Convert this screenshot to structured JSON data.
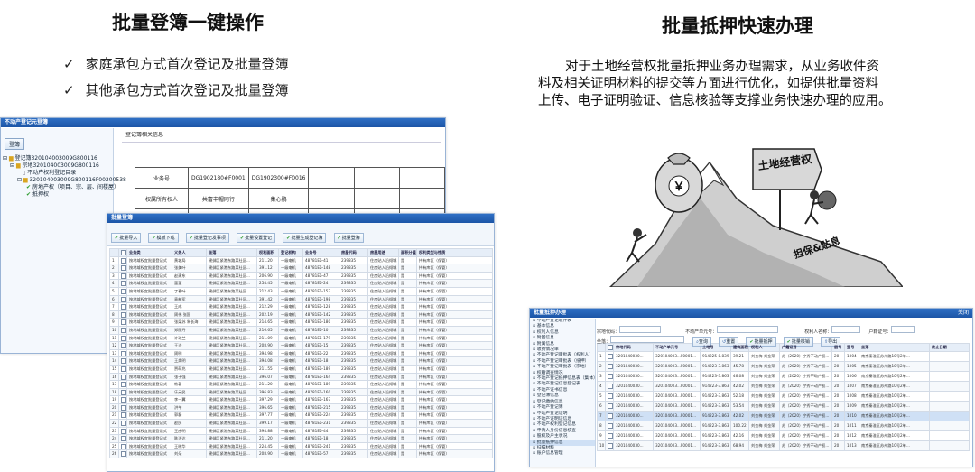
{
  "left_section": {
    "title": "批量登簿一键操作",
    "bullets": [
      "家庭承包方式首次登记及批量登簿",
      "其他承包方式首次登记及批量登簿"
    ],
    "bullet_mark": "✓"
  },
  "right_section": {
    "title": "批量抵押快速办理",
    "paragraph_lines": [
      "对于土地经营权批量抵押业务办理需求，从业务收件资",
      "料及相关证明材料的提交等方面进行优化，如提供批量资料",
      "上传、电子证明验证、信息核验等支撑业务快速办理的应用。"
    ]
  },
  "illustration": {
    "sign_text": "土地经营权",
    "bag_text": "￥",
    "slope_text": "担保&贴息"
  },
  "tree_window": {
    "title": "不动产登记元登簿",
    "button_label": "登簿",
    "items": [
      "登记簿320104003009G800116",
      "宗地320104003009G800116",
      "不动产权利登记目录",
      "320104003009G800116F00200538",
      "房地产权（项目、宗、层、间楼屋）",
      "抵押权"
    ],
    "panel_title": "登记簿相关信息"
  },
  "register_table": {
    "rows": [
      [
        "业务号",
        "DG1902180#F0001",
        "DG1902300#F0016",
        "",
        "",
        ""
      ],
      [
        "权属所有权人",
        "共富丰帽同行",
        "集心鹏",
        "",
        "",
        ""
      ],
      [
        "证件种类",
        "身份证",
        "户口簿",
        "",
        "",
        ""
      ]
    ]
  },
  "batch_window": {
    "title": "批量登簿",
    "toolbar": [
      "批量导入",
      "模板下载",
      "批量登记发事项",
      "批量设置登记",
      "批量生成登记簿",
      "批量登簿"
    ],
    "columns": [
      "",
      "",
      "业务类",
      "义务人",
      "坐落",
      "权利面积",
      "登记机构",
      "业务号",
      "房屋代码",
      "房屋用途",
      "面积分值",
      "权利类型与性质"
    ],
    "row_template": {
      "type": "按地域权宜批量登记式",
      "location": "建邺区紧港东路某社区...",
      "agency": "一级电机",
      "code": "239835",
      "usage": "住房贴入沿倾城",
      "area_flag": "是",
      "right": "持有库区（保管）"
    },
    "owners": [
      "黄坡局",
      "张美叶",
      "赵建东",
      "董董",
      "丁春叶",
      "袁新军",
      "王成",
      "周伟 张国",
      "张梁苏 朱长海",
      "郑丽丹",
      "许琼兰",
      "王沙",
      "周明",
      "王焕明",
      "贾萌兆",
      "张子强",
      "韩着",
      "乐元民",
      "李一翼",
      "洪芊",
      "郭磊",
      "赵民",
      "王彦明",
      "陈洪达",
      "王晓华",
      "刘朵"
    ],
    "areas": [
      "211.20",
      "391.12",
      "206.90",
      "254.45",
      "212.43",
      "391.42",
      "212.29",
      "202.19",
      "214.65",
      "216.65",
      "211.09",
      "208.90",
      "394.98",
      "394.08",
      "211.55",
      "396.07",
      "211.20",
      "396.83",
      "397.29",
      "396.65",
      "397.77",
      "399.17",
      "394.88",
      "211.20",
      "224.45",
      "208.90"
    ],
    "biz_nos": [
      "48781E5-41",
      "48781E5-148",
      "48781E5-47",
      "48781E5-24",
      "48781E5-157",
      "48781E5-198",
      "48781E5-128",
      "48781E5-142",
      "48781E5-180",
      "48781E5-10",
      "48781E5-179",
      "48781E5-15",
      "48781E5-22",
      "48781E5-18",
      "48781E5-189",
      "48781E5-164",
      "48781E5-189",
      "48781E5-160",
      "48781E5-167",
      "48781E5-215",
      "48781E5-224",
      "48781E5-231",
      "48781E5-44",
      "48781E5-18",
      "48781E5-241",
      "48781E5-57"
    ]
  },
  "mortgage_window": {
    "title": "批量抵押办理",
    "close_label": "关闭",
    "nav_items": [
      "不动产登记收件表",
      "基本信息",
      "权利人信息",
      "附图信息",
      "附属信息",
      "收费情况单",
      "不动产登记审批表（权利人）",
      "不动产登记审批表（抵押）",
      "不动产登记审批表（宗地）",
      "权籍调查情况",
      "不动产登记抵押信息表（集体）",
      "不动产登记信息登记表",
      "不动产证书信息",
      "登记簿信息",
      "登记缴纳信息",
      "不动产登记簿",
      "不动产登记证明",
      "不动产证明证信息",
      "不动产权利登记信息",
      "申请人身份信息核查",
      "股权及户主状况",
      "批量抵押信息",
      "扫描材料",
      "账户信息管理"
    ],
    "filters": [
      "宗地代码：",
      "不动产单元号：",
      "权利人名称：",
      "户籍证号："
    ],
    "filter2": "坐落：",
    "buttons": [
      "查询",
      "重置",
      "批量抵押",
      "批量核销",
      "导出"
    ],
    "columns": [
      "",
      "",
      "宗地代码",
      "不动产单元号",
      "土地号",
      "建筑面积",
      "权利人",
      "户籍证号",
      "层号",
      "室号",
      "坐落",
      "终止日期"
    ],
    "rows": [
      [
        "1",
        "",
        "3201040030...",
        "320104003...F0001...",
        "914225-8.839",
        "39.21",
        "刘金梅 刘金荣",
        "苏（2020）宁秀不动产权...",
        "20",
        "1004",
        "南京秦淮区苏州路10号2单..."
      ],
      [
        "2",
        "",
        "3201040030...",
        "320104003...F0001...",
        "914223-3.863",
        "45.78",
        "刘金梅 刘金荣",
        "苏（2020）宁秀不动产权...",
        "20",
        "1005",
        "南京秦淮区苏州路10号2单..."
      ],
      [
        "3",
        "",
        "3201040030...",
        "320104003...F0001...",
        "914223-3.863",
        "46.08",
        "刘金梅 刘金荣",
        "苏（2020）宁秀不动产权...",
        "20",
        "1006",
        "南京秦淮区苏州路10号2单..."
      ],
      [
        "4",
        "",
        "3201040030...",
        "320104003...F0001...",
        "914223-3.863",
        "42.02",
        "刘金梅 刘金荣",
        "苏（2020）宁秀不动产权...",
        "20",
        "1007",
        "南京秦淮区苏州路10号2单..."
      ],
      [
        "5",
        "",
        "3201040030...",
        "320104003...F0001...",
        "914223-3.863",
        "52.18",
        "刘金梅 刘金荣",
        "苏（2020）宁秀不动产权...",
        "20",
        "1008",
        "南京秦淮区苏州路10号2单..."
      ],
      [
        "6",
        "",
        "3201040030...",
        "320104003...F0001...",
        "914223-3.863",
        "53.54",
        "刘金梅 刘金荣",
        "苏（2020）宁秀不动产权...",
        "20",
        "1009",
        "南京秦淮区苏州路10号2单..."
      ],
      [
        "7",
        "",
        "3201040030...",
        "320104003...F0001...",
        "914223-3.863",
        "42.02",
        "刘金梅 刘金荣",
        "苏（2020）宁秀不动产权...",
        "20",
        "1010",
        "南京秦淮区苏州路10号2单..."
      ],
      [
        "8",
        "",
        "3201040030...",
        "320104003...F0001...",
        "914223-3.863",
        "100.22",
        "刘金梅 刘金荣",
        "苏（2020）宁秀不动产权...",
        "20",
        "1011",
        "南京秦淮区苏州路10号2单..."
      ],
      [
        "9",
        "",
        "3201040030...",
        "320104003...F0001...",
        "914223-3.863",
        "42.16",
        "刘金梅 刘金荣",
        "苏（2020）宁秀不动产权...",
        "20",
        "1012",
        "南京秦淮区苏州路10号2单..."
      ],
      [
        "10",
        "",
        "3201040030...",
        "320104003...F0001...",
        "914223-3.863",
        "68.94",
        "刘金梅 刘金荣",
        "苏（2020）宁秀不动产权...",
        "20",
        "1013",
        "南京秦淮区苏州路10号2单..."
      ]
    ]
  },
  "colors": {
    "titlebar": "#1c55a6",
    "accent_green": "#2a9a2a"
  }
}
